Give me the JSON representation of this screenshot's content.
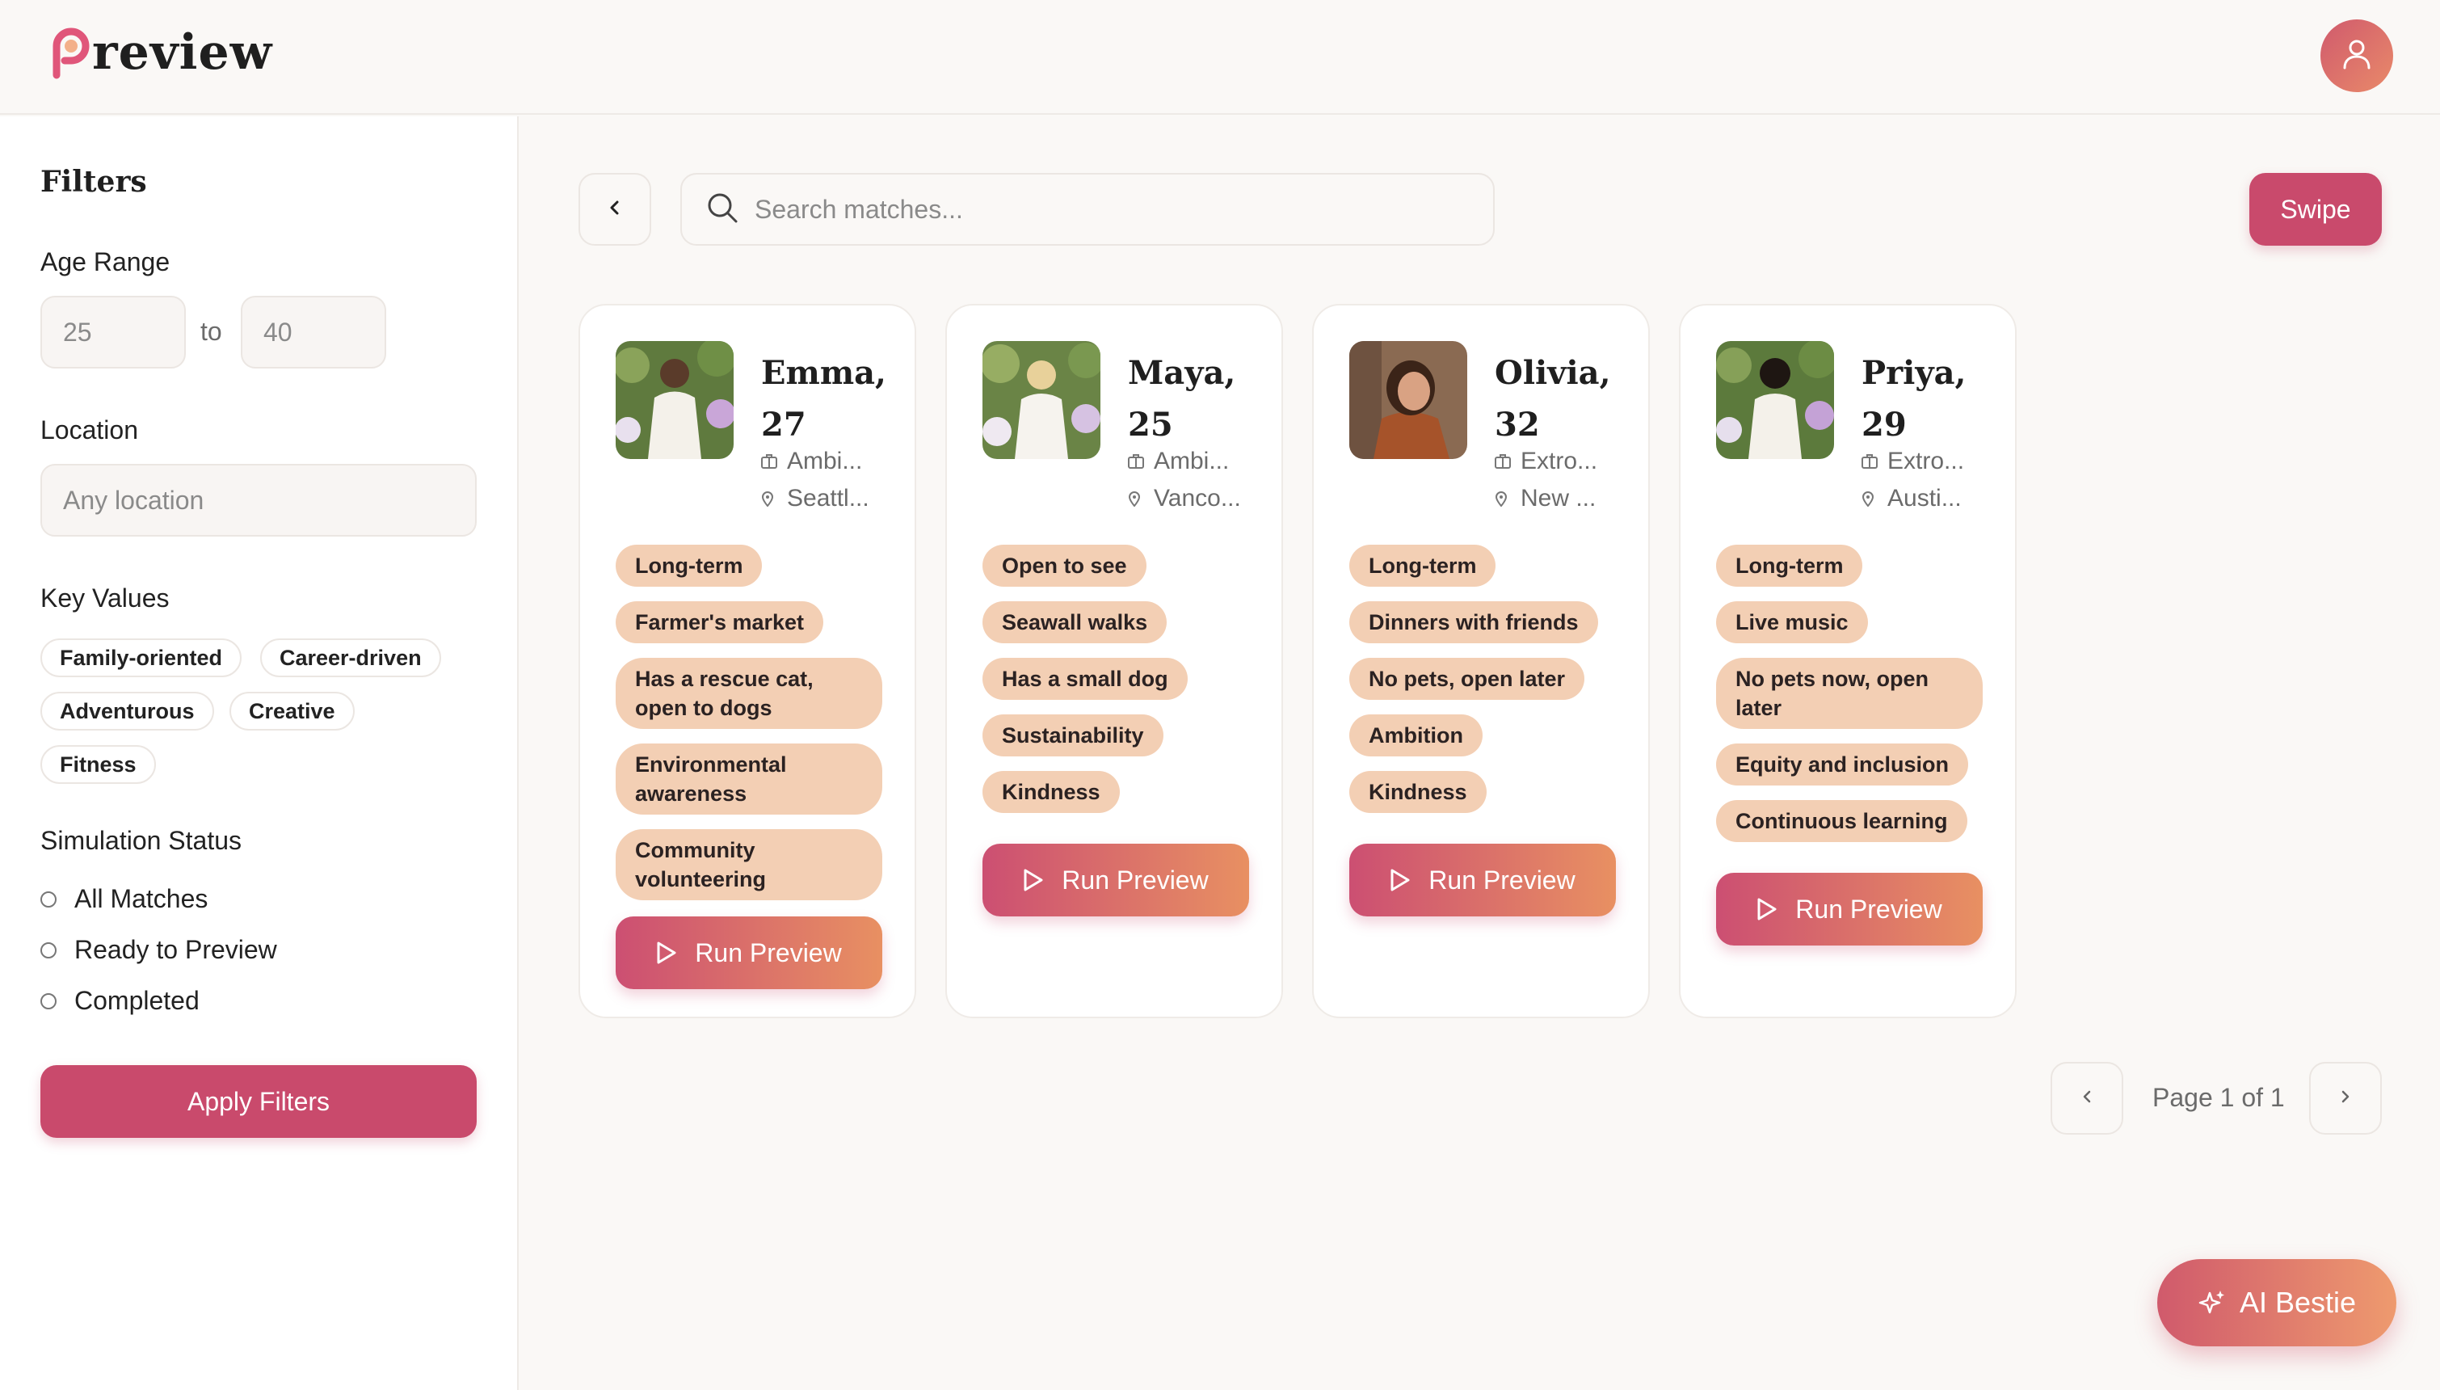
{
  "app": {
    "logo_text": "review",
    "accent": "#c94a6c",
    "tag_color": "#f3cfb4"
  },
  "header": {
    "profile_icon": "user-icon"
  },
  "filters": {
    "title": "Filters",
    "age_range_label": "Age Range",
    "age_min": "25",
    "age_to": "to",
    "age_max": "40",
    "location_label": "Location",
    "location_placeholder": "Any location",
    "key_values_label": "Key Values",
    "key_values": [
      "Family-oriented",
      "Career-driven",
      "Adventurous",
      "Creative",
      "Fitness"
    ],
    "simulation_label": "Simulation Status",
    "statuses": [
      "All Matches",
      "Ready to Preview",
      "Completed"
    ],
    "apply_label": "Apply Filters"
  },
  "toolbar": {
    "search_placeholder": "Search matches...",
    "swipe_label": "Swipe"
  },
  "matches": [
    {
      "name": "Emma,",
      "age": "27",
      "personality": "Ambi...",
      "location": "Seattl...",
      "tags": [
        "Long-term",
        "Farmer's market",
        "Has a rescue cat, open to dogs",
        "Environmental awareness",
        "Community volunteering"
      ]
    },
    {
      "name": "Maya,",
      "age": "25",
      "personality": "Ambi...",
      "location": "Vanco...",
      "tags": [
        "Open to see",
        "Seawall walks",
        "Has a small dog",
        "Sustainability",
        "Kindness"
      ]
    },
    {
      "name": "Olivia,",
      "age": "32",
      "personality": "Extro...",
      "location": "New ...",
      "tags": [
        "Long-term",
        "Dinners with friends",
        "No pets, open later",
        "Ambition",
        "Kindness"
      ]
    },
    {
      "name": "Priya,",
      "age": "29",
      "personality": "Extro...",
      "location": "Austi...",
      "tags": [
        "Long-term",
        "Live music",
        "No pets now, open later",
        "Equity and inclusion",
        "Continuous learning"
      ]
    }
  ],
  "run_preview_label": "Run Preview",
  "pagination": {
    "label": "Page 1 of 1"
  },
  "ai_bestie_label": "AI Bestie"
}
